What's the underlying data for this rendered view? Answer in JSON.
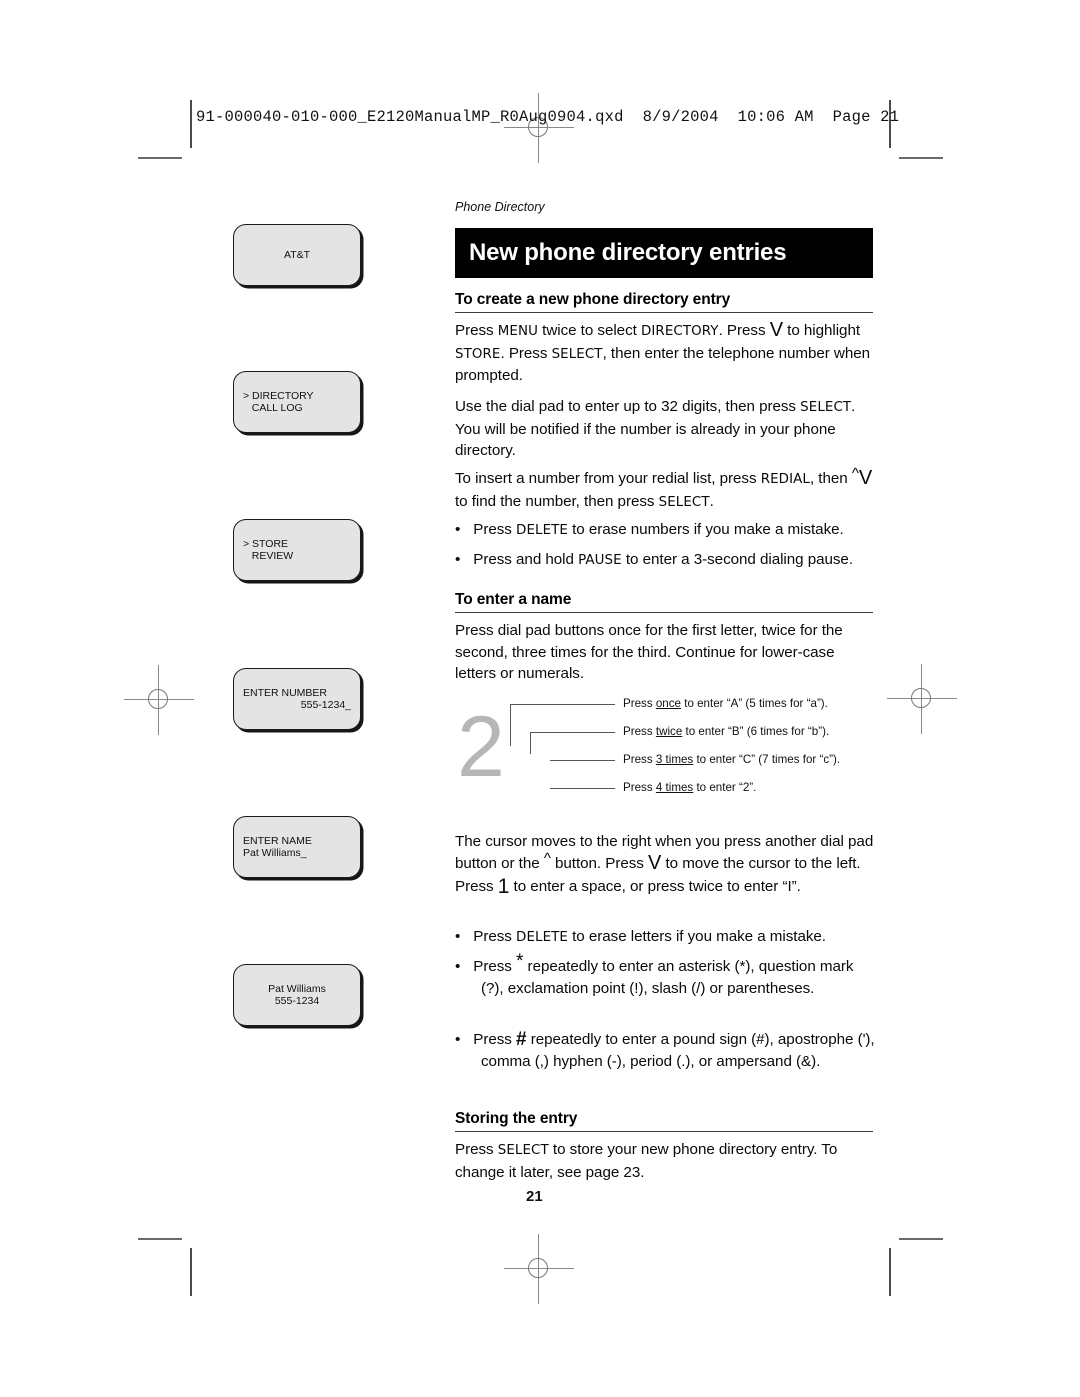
{
  "printer_header": "91-000040-010-000_E2120ManualMP_R0Aug0904.qxd  8/9/2004  10:06 AM  Page 21",
  "running_head": "Phone Directory",
  "title": "New phone directory entries",
  "page_number": "21",
  "lcd_screens": [
    {
      "name": "att-logo-screen",
      "lines": [
        {
          "text": "AT&T",
          "align": "center"
        }
      ]
    },
    {
      "name": "directory-menu-screen",
      "lines": [
        {
          "text": "> DIRECTORY",
          "align": "left"
        },
        {
          "text": "   CALL LOG",
          "align": "left"
        }
      ]
    },
    {
      "name": "store-menu-screen",
      "lines": [
        {
          "text": "> STORE",
          "align": "left"
        },
        {
          "text": "   REVIEW",
          "align": "left"
        }
      ]
    },
    {
      "name": "enter-number-screen",
      "lines": [
        {
          "text": "ENTER NUMBER",
          "align": "left"
        },
        {
          "text": "555-1234_",
          "align": "right"
        }
      ]
    },
    {
      "name": "enter-name-screen",
      "lines": [
        {
          "text": "ENTER NAME",
          "align": "left"
        },
        {
          "text": "Pat Williams_",
          "align": "left"
        }
      ]
    },
    {
      "name": "stored-entry-screen",
      "lines": [
        {
          "text": "Pat Williams",
          "align": "center"
        },
        {
          "text": "555-1234",
          "align": "center"
        }
      ]
    }
  ],
  "sections": {
    "create_entry": {
      "heading": "To create a new phone directory entry",
      "p1": {
        "a": "Press ",
        "k1": "MENU",
        "b": " twice to select ",
        "k2": "DIRECTORY",
        "c": ". Press ",
        "g": "V",
        "d": " to highlight ",
        "k3": "STORE",
        "e": ". Press ",
        "k4": "SELECT",
        "f": ", then enter the telephone number when prompted."
      },
      "p2": {
        "a": "Use the dial pad to enter up to 32 digits, then press ",
        "k1": "SELECT",
        "b": ".  You will be notified if the number is already in your phone directory."
      },
      "p3": {
        "a": "To insert a number from your redial list, press ",
        "k1": "REDIAL",
        "b": ", then ",
        "g1": "^",
        "g2": "V",
        "c": " to find the number, then press ",
        "k2": "SELECT",
        "d": "."
      },
      "bullets": [
        {
          "a": "Press ",
          "k": "DELETE",
          "b": " to erase numbers if you make a mistake."
        },
        {
          "a": "Press and hold ",
          "k": "PAUSE",
          "b": " to enter a 3-second dialing pause."
        }
      ]
    },
    "enter_name": {
      "heading": "To enter a name",
      "p1": "Press dial pad buttons once for the first letter, twice for the second, three times for the third. Continue for lower-case letters or numerals.",
      "callouts": {
        "digit": "2",
        "items": [
          {
            "pre": "Press ",
            "emph": "once",
            "post": " to enter “A” (5 times for “a”)."
          },
          {
            "pre": "Press ",
            "emph": "twice",
            "post": " to enter “B” (6 times for “b”)."
          },
          {
            "pre": "Press ",
            "emph": "3 times",
            "post": " to enter “C” (7 times for “c”)."
          },
          {
            "pre": "Press ",
            "emph": "4 times",
            "post": " to enter “2”."
          }
        ]
      },
      "p2": {
        "a": "The cursor moves to the right when you press another dial pad button or the ",
        "g1": "^",
        "b": " button. Press ",
        "g2": "V",
        "c": " to move the cursor to the left. Press ",
        "g3": "1",
        "d": " to enter a space, or press twice to enter “I”."
      },
      "bullets": [
        {
          "a": "Press ",
          "k": "DELETE",
          "b": " to erase letters if you make a mistake."
        }
      ],
      "bullet_star": {
        "a": "Press ",
        "g": "*",
        "b": " repeatedly to enter an asterisk (*), question mark (?), exclamation point (!), slash (/) or parentheses."
      },
      "bullet_pound": {
        "a": "Press ",
        "g": "#",
        "b": " repeatedly to enter a pound sign (#), apostrophe ('), comma (,) hyphen (-), period (.), or ampersand (&)."
      }
    },
    "storing": {
      "heading": "Storing the entry",
      "p1": {
        "a": "Press ",
        "k": "SELECT",
        "b": " to store your new phone directory entry. To change it later, see page 23."
      }
    }
  }
}
